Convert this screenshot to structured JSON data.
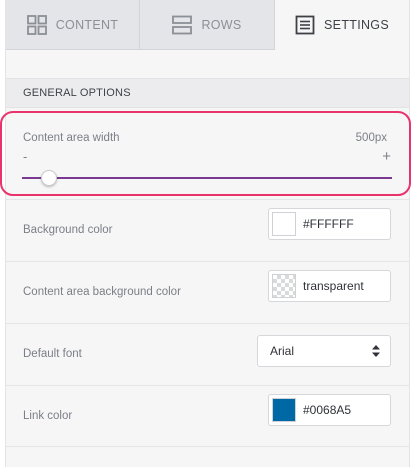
{
  "tabs": [
    {
      "label": "CONTENT",
      "icon": "grid-icon",
      "active": false
    },
    {
      "label": "ROWS",
      "icon": "rows-icon",
      "active": false
    },
    {
      "label": "SETTINGS",
      "icon": "settings-icon",
      "active": true
    }
  ],
  "section": {
    "title": "GENERAL OPTIONS"
  },
  "content_width": {
    "label": "Content area width",
    "value": "500px",
    "minus_label": "-",
    "plus_label": "+",
    "slider_fraction": 0.05
  },
  "background_color": {
    "label": "Background color",
    "value": "#FFFFFF",
    "swatch": "#ffffff"
  },
  "content_area_background": {
    "label": "Content area background color",
    "value": "transparent",
    "swatch": "transparent"
  },
  "default_font": {
    "label": "Default font",
    "value": "Arial"
  },
  "link_color": {
    "label": "Link color",
    "value": "#0068A5",
    "swatch": "#0068a5"
  },
  "colors": {
    "accent_slider": "#7a3a92",
    "highlight": "#e8336d"
  }
}
